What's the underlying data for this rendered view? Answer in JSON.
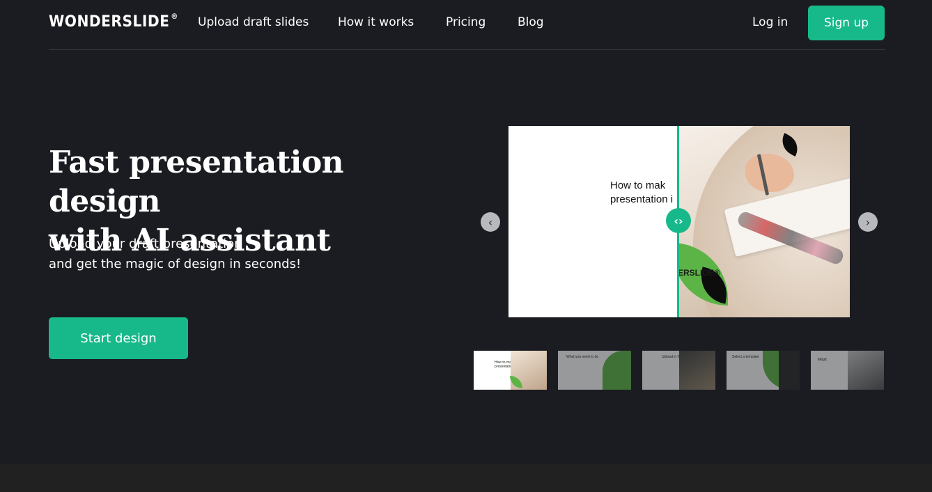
{
  "header": {
    "logo": "WONDERSLIDE",
    "logo_mark": "®",
    "nav": [
      "Upload draft slides",
      "How it works",
      "Pricing",
      "Blog"
    ],
    "login_label": "Log in",
    "signup_label": "Sign up"
  },
  "hero": {
    "title_line1": "Fast presentation design",
    "title_line2": "with AI assistant",
    "subtitle_line1": "Upload your draft presentation",
    "subtitle_line2": "and get the magic of design in seconds!",
    "cta_label": "Start design"
  },
  "carousel": {
    "prev_icon": "chevron-left-icon",
    "next_icon": "chevron-right-icon",
    "prev_glyph": "‹",
    "next_glyph": "›",
    "handle_glyph": "‹›",
    "slide_text_line1": "How to mak",
    "slide_text_line2": "presentation i",
    "slide_logo_text": "ERSLIDE®",
    "thumbnails": [
      {
        "text": "How to make\npresentation"
      },
      {
        "text": "What you need to do"
      },
      {
        "text": "Upload in Wonderslide"
      },
      {
        "text": "Select a template"
      },
      {
        "text": "Magic"
      }
    ]
  },
  "colors": {
    "background": "#1b1c21",
    "accent": "#17b98a",
    "leaf_green": "#5db446"
  }
}
